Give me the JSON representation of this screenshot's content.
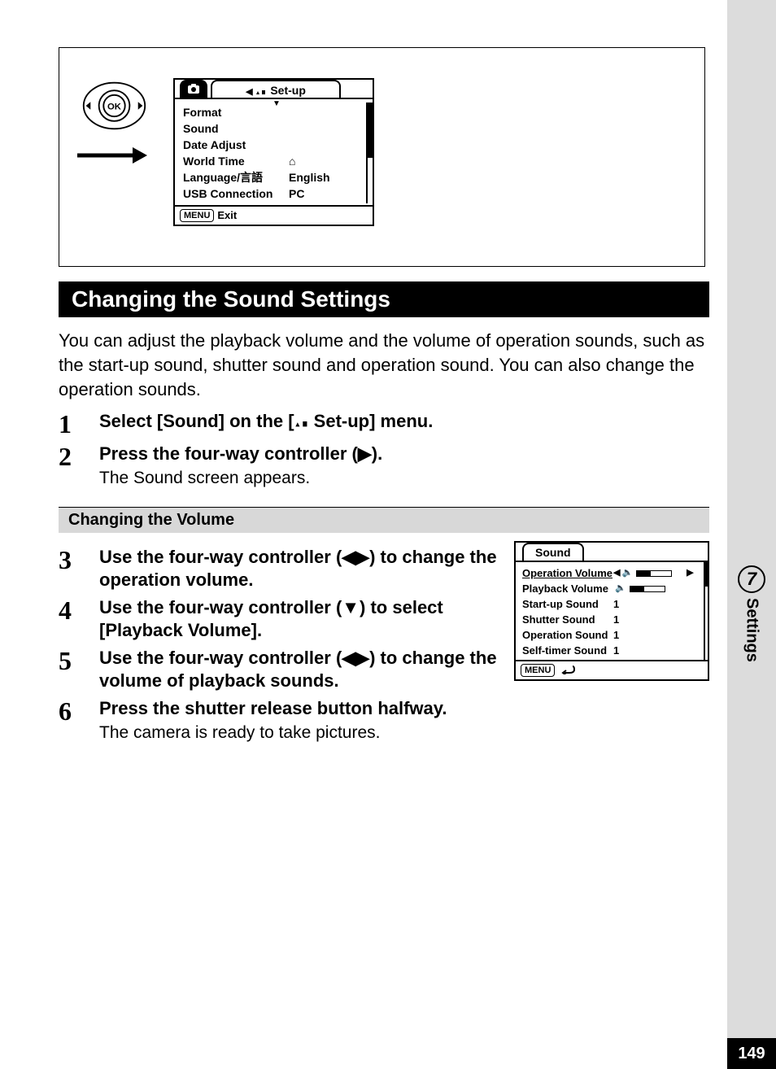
{
  "sidebar": {
    "chapter_num": "7",
    "chapter_label": "Settings"
  },
  "page_number": "149",
  "setup_screen": {
    "tab_label": "Set-up",
    "items": {
      "format": "Format",
      "sound": "Sound",
      "date_adjust": "Date Adjust",
      "world_time": "World Time",
      "language_k": "Language/言語",
      "language_v": "English",
      "usb_k": "USB Connection",
      "usb_v": "PC"
    },
    "footer_btn": "MENU",
    "footer_label": "Exit"
  },
  "section_title": "Changing the Sound Settings",
  "intro": "You can adjust the playback volume and the volume of operation sounds, such as the start-up sound, shutter sound and operation sound. You can also change the operation sounds.",
  "steps_top": [
    {
      "n": "1",
      "title_pre": "Select [Sound] on the [",
      "title_post": " Set-up] menu."
    },
    {
      "n": "2",
      "title": "Press the four-way controller (▶).",
      "desc": "The Sound screen appears."
    }
  ],
  "subheading": "Changing the Volume",
  "steps_bottom": [
    {
      "n": "3",
      "title": "Use the four-way controller (◀▶) to change the operation volume."
    },
    {
      "n": "4",
      "title": "Use the four-way controller (▼) to select [Playback Volume]."
    },
    {
      "n": "5",
      "title": "Use the four-way controller (◀▶) to change the volume of playback sounds."
    },
    {
      "n": "6",
      "title": "Press the shutter release button halfway.",
      "desc": "The camera is ready to take pictures."
    }
  ],
  "sound_screen": {
    "title": "Sound",
    "rows": {
      "op_vol": "Operation Volume",
      "pb_vol": "Playback Volume",
      "startup_k": "Start-up Sound",
      "startup_v": "1",
      "shutter_k": "Shutter Sound",
      "shutter_v": "1",
      "opsnd_k": "Operation Sound",
      "opsnd_v": "1",
      "self_k": "Self-timer Sound",
      "self_v": "1"
    },
    "footer_btn": "MENU"
  }
}
